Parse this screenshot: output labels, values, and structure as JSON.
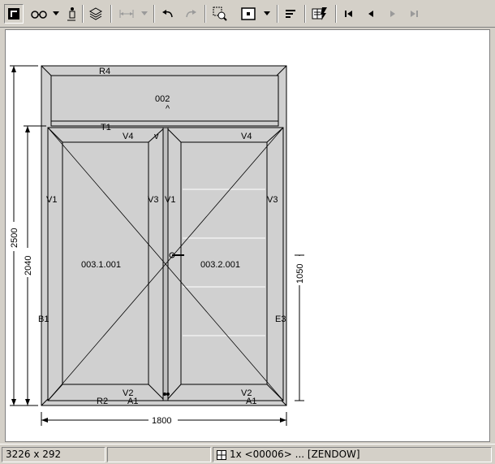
{
  "toolbar": {
    "buttons": [
      {
        "name": "app-logo-button",
        "icon": "square-logo-icon"
      },
      {
        "name": "view-glasses-button",
        "icon": "glasses-icon"
      },
      {
        "name": "view-options-dropdown",
        "icon": "chevron-down-icon"
      },
      {
        "name": "person-button",
        "icon": "person-icon"
      },
      {
        "name": "layers-button",
        "icon": "layers-icon"
      },
      {
        "name": "dimension-button",
        "icon": "dimension-icon"
      },
      {
        "name": "dimension-dropdown",
        "icon": "chevron-down-icon"
      },
      {
        "name": "undo-button",
        "icon": "undo-icon"
      },
      {
        "name": "redo-button",
        "icon": "redo-icon"
      },
      {
        "name": "zoom-region-button",
        "icon": "zoom-region-icon"
      },
      {
        "name": "frame-select-button",
        "icon": "frame-icon"
      },
      {
        "name": "frame-select-dropdown",
        "icon": "chevron-down-icon"
      },
      {
        "name": "align-text-button",
        "icon": "align-left-icon"
      },
      {
        "name": "properties-button",
        "icon": "properties-icon"
      },
      {
        "name": "first-record-button",
        "icon": "first-icon"
      },
      {
        "name": "previous-record-button",
        "icon": "previous-icon"
      },
      {
        "name": "next-record-button",
        "icon": "next-icon"
      },
      {
        "name": "last-record-button",
        "icon": "last-icon"
      }
    ]
  },
  "drawing": {
    "labels": {
      "top_frame": "R4",
      "transom_id": "002",
      "transom_mark": "^",
      "mullion_top": "T1",
      "sash_left_top": "V4",
      "sash_left_mark": "v",
      "sash_right_top": "V4",
      "sash_left_left": "V1",
      "sash_left_right": "V3",
      "sash_right_left": "V1",
      "sash_right_right": "V3",
      "sash_left_id": "003.1.001",
      "sash_right_id": "003.2.001",
      "frame_left": "B1",
      "frame_right": "E3",
      "sash_left_bottom": "V2",
      "sash_right_bottom": "V2",
      "frame_bottom": "R2",
      "bottom_left_a": "A1",
      "bottom_right_a": "A1"
    },
    "dimensions": {
      "total_height": "2500",
      "sash_height": "2040",
      "total_width": "1800",
      "handle_height": "1050"
    }
  },
  "status": {
    "size": "3226 x 292",
    "item": "1x <00006> ... [ZENDOW]"
  }
}
